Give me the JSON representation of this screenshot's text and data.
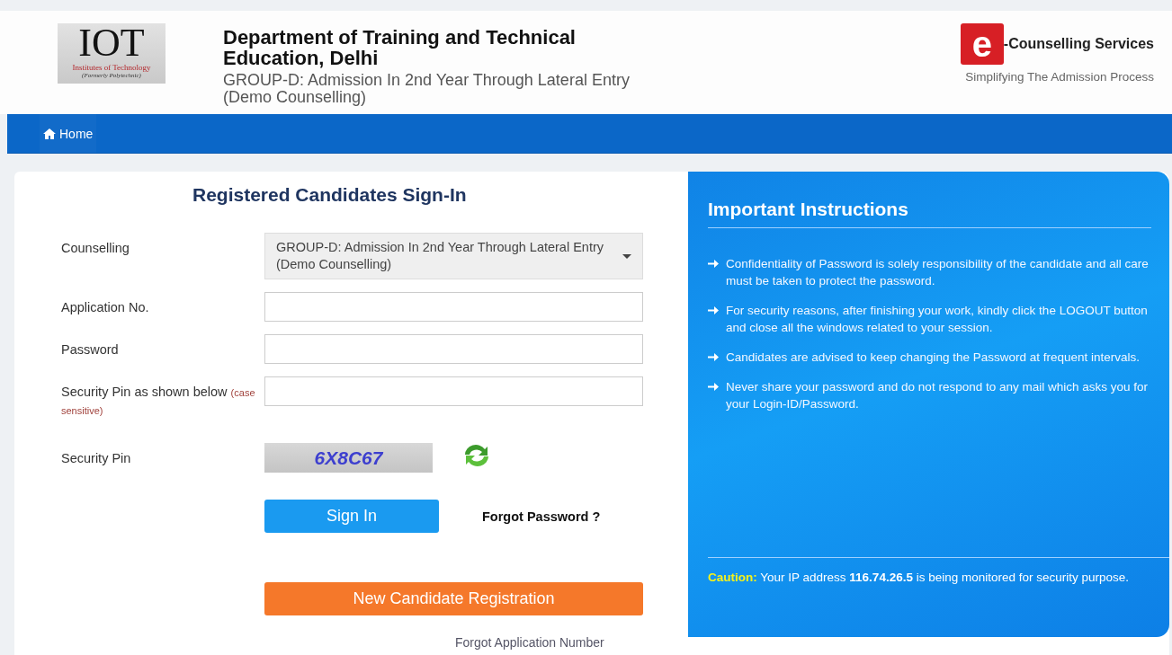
{
  "header": {
    "logo": {
      "title": "IOT",
      "subtitle": "Institutes of Technology",
      "note": "(Formerly Polytechnic)"
    },
    "title": "Department of Training and Technical Education, Delhi",
    "subtitle": "GROUP-D: Admission In 2nd Year Through Lateral Entry (Demo Counselling)",
    "brand": {
      "letter": "e",
      "name": "-Counselling Services",
      "tagline": "Simplifying The Admission Process"
    }
  },
  "nav": [
    {
      "label": "Home"
    }
  ],
  "signin": {
    "title": "Registered Candidates Sign-In",
    "fields": [
      {
        "kind": "select",
        "label": "Counselling",
        "value": "GROUP-D: Admission In 2nd Year Through Lateral Entry (Demo Counselling)"
      },
      {
        "kind": "text",
        "label": "Application No."
      },
      {
        "kind": "password",
        "label": "Password"
      },
      {
        "kind": "text",
        "label": "Security Pin as shown below",
        "hint": "(case sensitive)"
      },
      {
        "kind": "captcha",
        "label": "Security Pin",
        "value": "6X8C67"
      }
    ],
    "sign_in": "Sign In",
    "forgot_password": "Forgot Password ?",
    "register": "New Candidate Registration",
    "forgot_application": "Forgot Application Number"
  },
  "instructions": {
    "title": "Important Instructions",
    "items": [
      "Confidentiality of Password is solely responsibility of the candidate and all care must be taken to protect the password.",
      "For security reasons, after finishing your work, kindly click the LOGOUT button and close all the windows related to your session.",
      "Candidates are advised to keep changing the Password at frequent intervals.",
      "Never share your password and do not respond to any mail which asks you for your Login-ID/Password."
    ],
    "caution": {
      "label": "Caution:",
      "text": "Your IP address **116.74.26.5** is being monitored for security purpose."
    }
  }
}
